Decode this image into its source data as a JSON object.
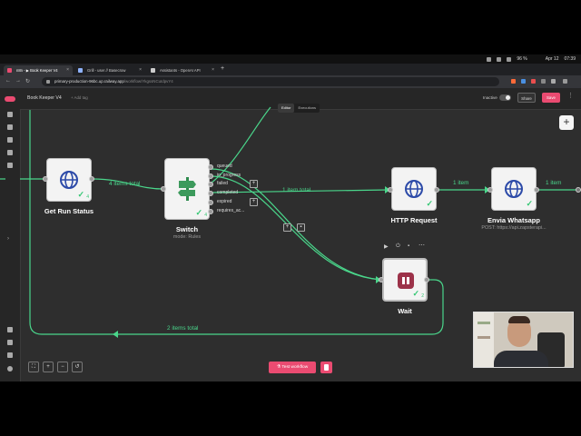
{
  "os_bar": {
    "battery": "96 %",
    "date": "Apr 12",
    "time": "07:39"
  },
  "browser": {
    "tabs": [
      {
        "label": "n8n - ▶ Book Keeper V4",
        "active": true
      },
      {
        "label": "Grill - user // Basecrow",
        "active": false
      },
      {
        "label": "Assistants - OpenAI API",
        "active": false
      }
    ],
    "url_host": "primary-production-96bc.up.railway.app",
    "url_path": "/workflow/YkgssNCuIdpvY4"
  },
  "app": {
    "workflow_name": "Book Keeper V4",
    "add_tag": "+ Add tag",
    "inactive_label": "Inactive",
    "share_label": "Share",
    "save_label": "Save",
    "mode_tabs": [
      "Editor",
      "Executions"
    ],
    "active_mode": "Editor"
  },
  "nodes": {
    "get_run_status": {
      "label": "Get Run Status",
      "count": "4"
    },
    "switch": {
      "label": "Switch",
      "subtitle": "mode: Rules",
      "count": "4",
      "outputs": [
        "queued",
        "in_progress",
        "failed",
        "completed",
        "expired",
        "requires_ac..."
      ]
    },
    "http_request": {
      "label": "HTTP Request"
    },
    "envia_whatsapp": {
      "label": "Envia Whatsapp",
      "subtitle": "POST: https://api.zapsterapi..."
    },
    "wait": {
      "label": "Wait",
      "count": "2"
    }
  },
  "connections": {
    "getrun_to_switch": "4 items total",
    "switch_to_http": "1 item total",
    "http_to_whatsapp": "1 item",
    "whatsapp_out": "1 item",
    "wait_loop": "2 items total"
  },
  "footer": {
    "test_label": "Test workflow"
  },
  "colors": {
    "accent": "#ea4b71",
    "success": "#35c774",
    "edge": "#4ad68b",
    "canvas": "#2e2e2e"
  },
  "icons": [
    "globe-icon",
    "signpost-icon",
    "pause-icon",
    "check-icon",
    "play-icon",
    "power-icon",
    "trash-icon",
    "ellipsis-icon",
    "plus-icon",
    "zoom-in-icon",
    "zoom-out-icon",
    "fit-view-icon",
    "undo-icon"
  ]
}
